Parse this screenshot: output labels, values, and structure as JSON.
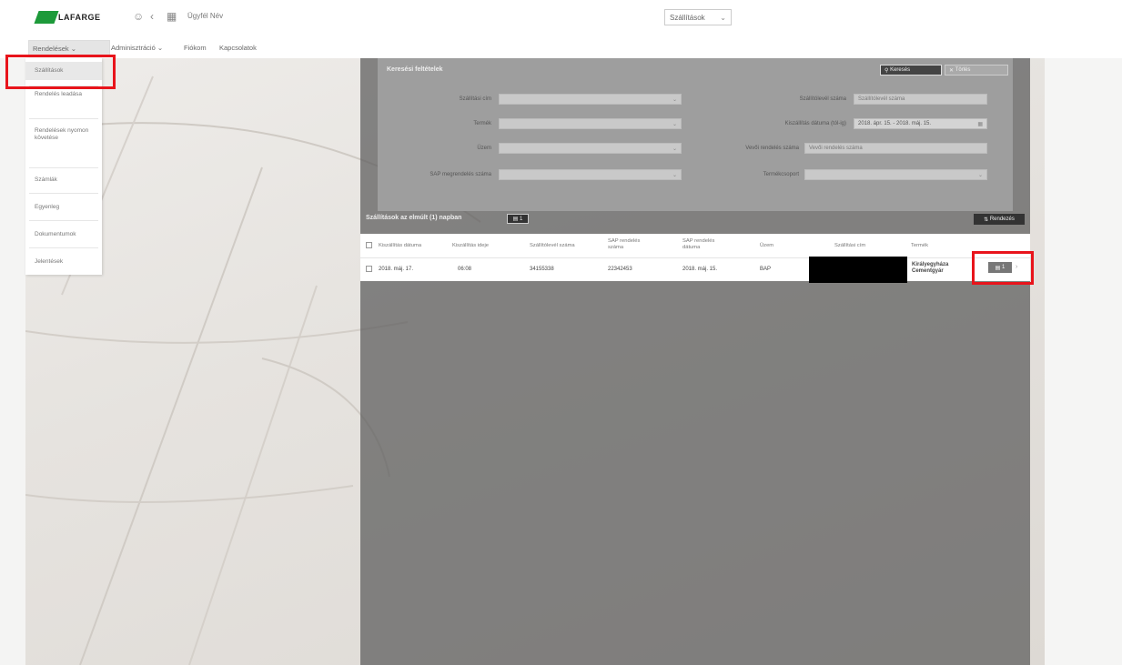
{
  "header": {
    "logo_text": "LAFARGE",
    "icons": [
      "user-icon",
      "back-icon",
      "grid-icon"
    ],
    "user_name": "Ügyfél Név",
    "center_select": "Szállítások",
    "center_select_icon": "chevron-down-icon"
  },
  "nav": {
    "items": [
      "Rendelések",
      "Adminisztráció",
      "Fiókom",
      "Kapcsolatok"
    ]
  },
  "dropdown": {
    "items": [
      "Szállítások",
      "Rendelés leadása",
      "Rendelések nyomon követése",
      "Számlák",
      "Egyenleg",
      "Dokumentumok",
      "Jelentések"
    ]
  },
  "filter": {
    "title": "Keresési feltételek",
    "btn_search": "Keresés",
    "btn_clear": "Törlés",
    "labels": {
      "delivery_address": "Szállítási cím",
      "product": "Termék",
      "plant": "Üzem",
      "sap_order_number": "SAP megrendelés száma",
      "delivery_note_number": "Szállítólevél száma",
      "dispatch_date": "Kiszállítás dátuma (tól-ig)",
      "customer_order_number": "Vevői rendelés száma",
      "product_group": "Termékcsoport"
    },
    "placeholders": {
      "delivery_note_number": "Szállítólevél száma",
      "customer_order_number": "Vevői rendelés száma"
    },
    "date_range": "2018. ápr. 15. - 2018. máj. 15."
  },
  "results": {
    "title": "Szállítások az elmúlt (1) napban",
    "count": "1",
    "sort_label": "Rendezés"
  },
  "table": {
    "columns": [
      "Kiszállítás dátuma",
      "Kiszállítás ideje",
      "Szállítólevél száma",
      "SAP rendelés száma",
      "SAP rendelés dátuma",
      "Üzem",
      "Szállítási cím",
      "Termék"
    ],
    "rows": [
      {
        "date": "2018. máj. 17.",
        "time": "06:08",
        "delivery_note": "34155338",
        "sap_number": "22342453",
        "sap_date": "2018. máj. 15.",
        "plant": "BAP",
        "address": "",
        "product": "Királyegyháza Cementgyár",
        "action_count": "1"
      }
    ]
  },
  "colors": {
    "highlight": "#e8141b",
    "brand": "#1d9a3a"
  }
}
